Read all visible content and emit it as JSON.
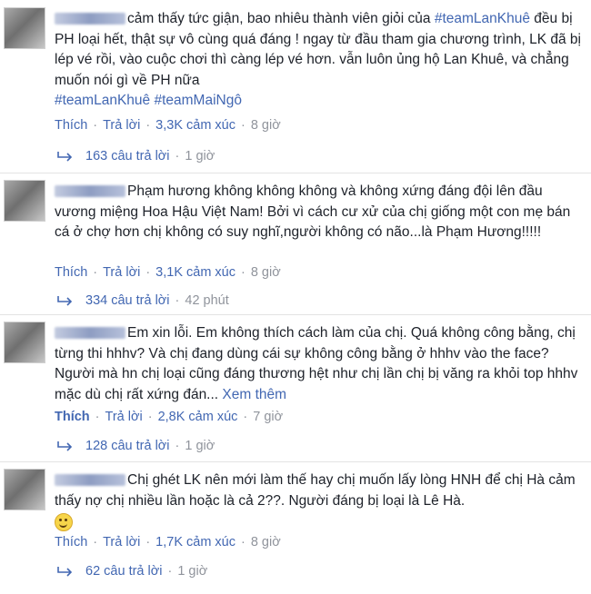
{
  "comments": [
    {
      "text_pre": "cảm thấy tức giận, bao nhiêu thành viên giỏi của ",
      "tag1": "#teamLanKhuê",
      "text_mid": " đều bị PH loại hết, thật sự vô cùng quá đáng ! ngay từ đầu tham gia chương trình, LK đã bị lép vé rồi, vào cuộc chơi thì càng lép vé hơn. vẫn luôn ủng hộ Lan Khuê, và chẳng muốn nói gì về PH nữa",
      "tag2": "#teamLanKhuê",
      "tag3": "#teamMaiNgô",
      "like": "Thích",
      "reply": "Trả lời",
      "reactions": "3,3K cảm xúc",
      "time": "8 giờ",
      "replies_count": "163 câu trả lời",
      "replies_time": "1 giờ"
    },
    {
      "text": "Phạm hương không không không và không xứng đáng đội lên đầu vương miệng Hoa Hậu Việt Nam! Bởi vì cách cư xử của chị giống một con mẹ bán cá ở chợ hơn chị không có suy nghĩ,người không có não...là Phạm Hương!!!!!",
      "like": "Thích",
      "reply": "Trả lời",
      "reactions": "3,1K cảm xúc",
      "time": "8 giờ",
      "replies_count": "334 câu trả lời",
      "replies_time": "42 phút"
    },
    {
      "text": "Em xin lỗi. Em không thích cách làm của chị. Quá không công bằng, chị từng thi hhhv? Và chị đang dùng cái sự không công bằng ở hhhv vào the face? Người mà hn chị loại cũng đáng thương hệt như chị lần chị bị văng ra khỏi top hhhv mặc dù chị rất xứng đán...",
      "see_more": "Xem thêm",
      "like": "Thích",
      "reply": "Trả lời",
      "reactions": "2,8K cảm xúc",
      "time": "7 giờ",
      "replies_count": "128 câu trả lời",
      "replies_time": "1 giờ"
    },
    {
      "text": "Chị ghét LK nên mới làm thế hay chị muốn lấy lòng HNH để chị Hà cảm thấy nợ chị nhiều lần hoặc là cả 2??. Người đáng bị loại là Lê Hà.",
      "like": "Thích",
      "reply": "Trả lời",
      "reactions": "1,7K cảm xúc",
      "time": "8 giờ",
      "replies_count": "62 câu trả lời",
      "replies_time": "1 giờ"
    }
  ],
  "colors": {
    "link": "#4267b2",
    "meta": "#90949c",
    "text": "#1d2129"
  },
  "icons": [
    "reply-arrow-icon",
    "smiley-emoji-icon",
    "avatar"
  ]
}
